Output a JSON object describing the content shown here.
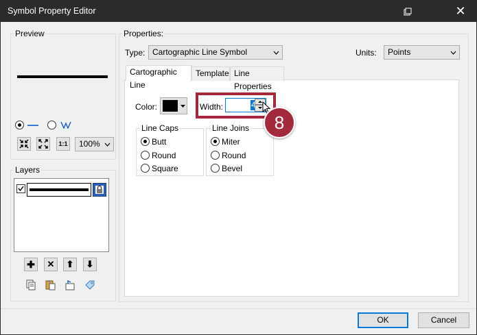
{
  "window": {
    "title": "Symbol Property Editor",
    "close_glyph": "✕",
    "help_glyph": "⧉"
  },
  "preview": {
    "label": "Preview",
    "zoom": "100%",
    "tool_glyphs": {
      "shrink": "⇲",
      "expand": "⤢",
      "actual": "1:1"
    }
  },
  "layers": {
    "label": "Layers",
    "action_glyphs": {
      "add": "✚",
      "remove": "✕",
      "up": "⬆",
      "down": "⬇"
    }
  },
  "properties": {
    "label": "Properties:",
    "type_label": "Type:",
    "type_value": "Cartographic Line Symbol",
    "units_label": "Units:",
    "units_value": "Points",
    "tabs": [
      {
        "label": "Cartographic Line",
        "active": true
      },
      {
        "label": "Template",
        "active": false
      },
      {
        "label": "Line Properties",
        "active": false
      }
    ],
    "color_label": "Color:",
    "color_value": "#000000",
    "width_label": "Width:",
    "width_value": "4",
    "line_caps": {
      "label": "Line Caps",
      "options": [
        {
          "label": "Butt",
          "selected": true
        },
        {
          "label": "Round",
          "selected": false
        },
        {
          "label": "Square",
          "selected": false
        }
      ]
    },
    "line_joins": {
      "label": "Line Joins",
      "options": [
        {
          "label": "Miter",
          "selected": true
        },
        {
          "label": "Round",
          "selected": false
        },
        {
          "label": "Bevel",
          "selected": false
        }
      ]
    }
  },
  "buttons": {
    "ok": "OK",
    "cancel": "Cancel"
  },
  "callout": {
    "number": "8",
    "color": "#a32a3c"
  }
}
